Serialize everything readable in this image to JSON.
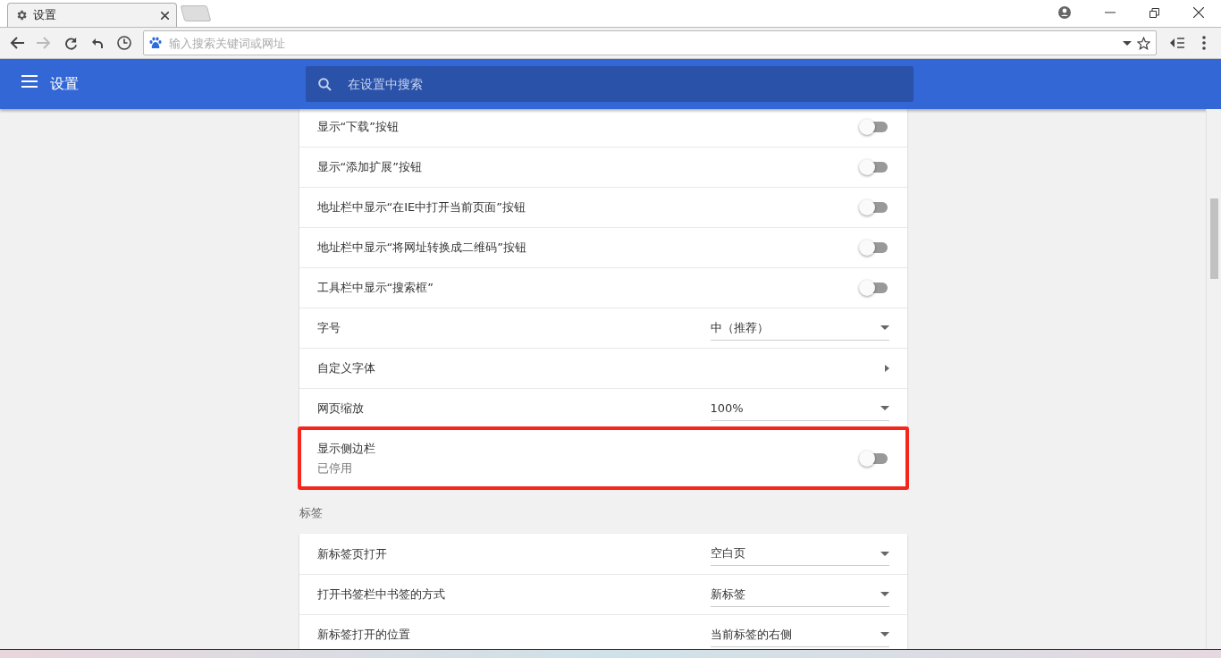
{
  "tab": {
    "title": "设置",
    "selected": true
  },
  "address": {
    "placeholder": "输入搜索关键词或网址"
  },
  "header": {
    "title": "设置",
    "search_placeholder": "在设置中搜索"
  },
  "sections": [
    {
      "rows": [
        {
          "kind": "toggle",
          "label": "显示“下载”按钮",
          "on": false
        },
        {
          "kind": "toggle",
          "label": "显示“添加扩展”按钮",
          "on": false
        },
        {
          "kind": "toggle",
          "label": "地址栏中显示“在IE中打开当前页面”按钮",
          "on": false
        },
        {
          "kind": "toggle",
          "label": "地址栏中显示“将网址转换成二维码”按钮",
          "on": false
        },
        {
          "kind": "toggle",
          "label": "工具栏中显示“搜索框”",
          "on": false
        },
        {
          "kind": "select",
          "label": "字号",
          "value": "中（推荐）"
        },
        {
          "kind": "link",
          "label": "自定义字体"
        },
        {
          "kind": "select",
          "label": "网页缩放",
          "value": "100%"
        },
        {
          "kind": "toggle",
          "label": "显示侧边栏",
          "sublabel": "已停用",
          "on": false,
          "highlighted": true
        }
      ]
    },
    {
      "title": "标签",
      "rows": [
        {
          "kind": "select",
          "label": "新标签页打开",
          "value": "空白页"
        },
        {
          "kind": "select",
          "label": "打开书签栏中书签的方式",
          "value": "新标签"
        },
        {
          "kind": "select",
          "label": "新标签打开的位置",
          "value": "当前标签的右侧"
        }
      ]
    }
  ]
}
